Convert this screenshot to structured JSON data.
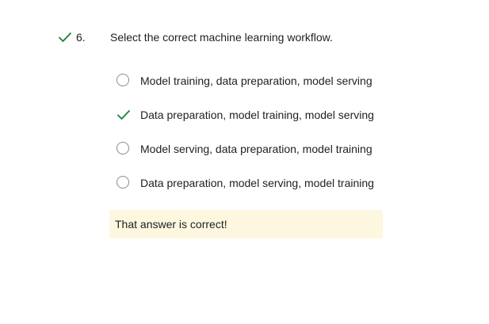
{
  "question": {
    "number": "6.",
    "text": "Select the correct machine learning workflow.",
    "status_icon": "checkmark-icon",
    "status_color": "#188038"
  },
  "options": [
    {
      "label": "Model training, data preparation, model serving",
      "state": "unselected"
    },
    {
      "label": "Data preparation, model training, model serving",
      "state": "correct-selected"
    },
    {
      "label": "Model serving, data preparation, model training",
      "state": "unselected"
    },
    {
      "label": "Data preparation, model serving, model training",
      "state": "unselected"
    }
  ],
  "feedback": {
    "text": "That answer is correct!",
    "background": "#fef7e0"
  },
  "colors": {
    "correct_green": "#188038",
    "radio_border": "#8c8c8c",
    "text": "#1f1f1f"
  }
}
